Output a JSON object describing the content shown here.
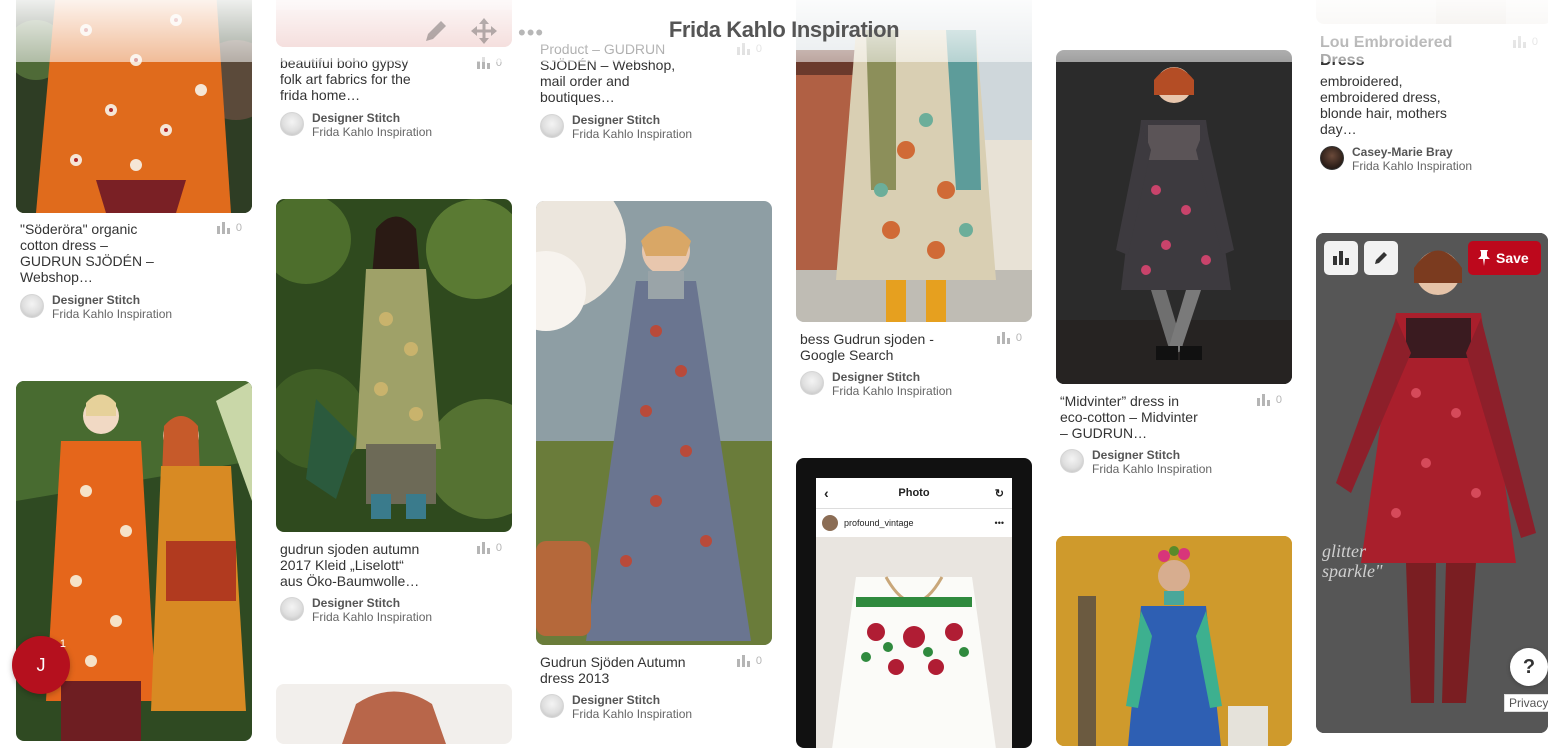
{
  "header": {
    "title": "Frida Kahlo Inspiration",
    "edit_icon": "pencil-icon",
    "move_icon": "move-icon",
    "more_icon": "more-dots-icon"
  },
  "pins": [
    {
      "id": "p1",
      "title": "\"Söderöra\" organic cotton dress – GUDRUN SJÖDÉN – Webshop…",
      "count": "0",
      "pinner": "Designer Stitch",
      "board": "Frida Kahlo Inspiration"
    },
    {
      "id": "p2",
      "title": "",
      "count": "",
      "pinner": "",
      "board": ""
    },
    {
      "id": "p3",
      "title": "beautiful boho gypsy folk art fabrics for the frida home…",
      "count": "0",
      "pinner": "Designer Stitch",
      "board": "Frida Kahlo Inspiration"
    },
    {
      "id": "p4",
      "title": "gudrun sjoden autumn 2017 Kleid „Liselott“ aus Öko-Baumwolle…",
      "count": "0",
      "pinner": "Designer Stitch",
      "board": "Frida Kahlo Inspiration"
    },
    {
      "id": "p5",
      "title": "Product – GUDRUN SJÖDÉN – Webshop, mail order and boutiques…",
      "count": "0",
      "pinner": "Designer Stitch",
      "board": "Frida Kahlo Inspiration"
    },
    {
      "id": "p6",
      "title": "Gudrun Sjöden Autumn dress 2013",
      "count": "0",
      "pinner": "Designer Stitch",
      "board": "Frida Kahlo Inspiration"
    },
    {
      "id": "p7",
      "title": "bess Gudrun sjoden - Google Search",
      "count": "0",
      "pinner": "Designer Stitch",
      "board": "Frida Kahlo Inspiration"
    },
    {
      "id": "p8",
      "title": "",
      "count": "",
      "pinner": "",
      "board": ""
    },
    {
      "id": "p9",
      "title": "“Midvinter” dress in eco-cotton – Midvinter – GUDRUN SJÖDÉN…",
      "count": "0",
      "pinner": "Designer Stitch",
      "board": "Frida Kahlo Inspiration"
    },
    {
      "id": "p10",
      "title": "",
      "count": "",
      "pinner": "",
      "board": ""
    },
    {
      "id": "p11",
      "title": "Lou Embroidered Dress",
      "description": "embroidered, embroidered dress, blonde hair, mothers day…",
      "count": "0",
      "pinner": "Casey-Marie Bray",
      "board": "Frida Kahlo Inspiration"
    },
    {
      "id": "p12",
      "title": "",
      "count": "",
      "pinner": "",
      "board": ""
    }
  ],
  "screenshot_app": {
    "title": "Photo",
    "username": "profound_vintage"
  },
  "overlay": {
    "save_label": "Save",
    "stats_icon": "stats-icon",
    "edit_icon": "pencil-icon",
    "pin_icon": "pushpin-icon",
    "image_text": "glitter\nsparkle\""
  },
  "user_bubble": {
    "initial": "J",
    "notifications": "1"
  },
  "help": {
    "label": "?"
  },
  "privacy": {
    "label": "Privacy"
  },
  "colors": {
    "brand_red": "#bd081c",
    "text": "#333333",
    "muted": "#b5b5b5"
  }
}
